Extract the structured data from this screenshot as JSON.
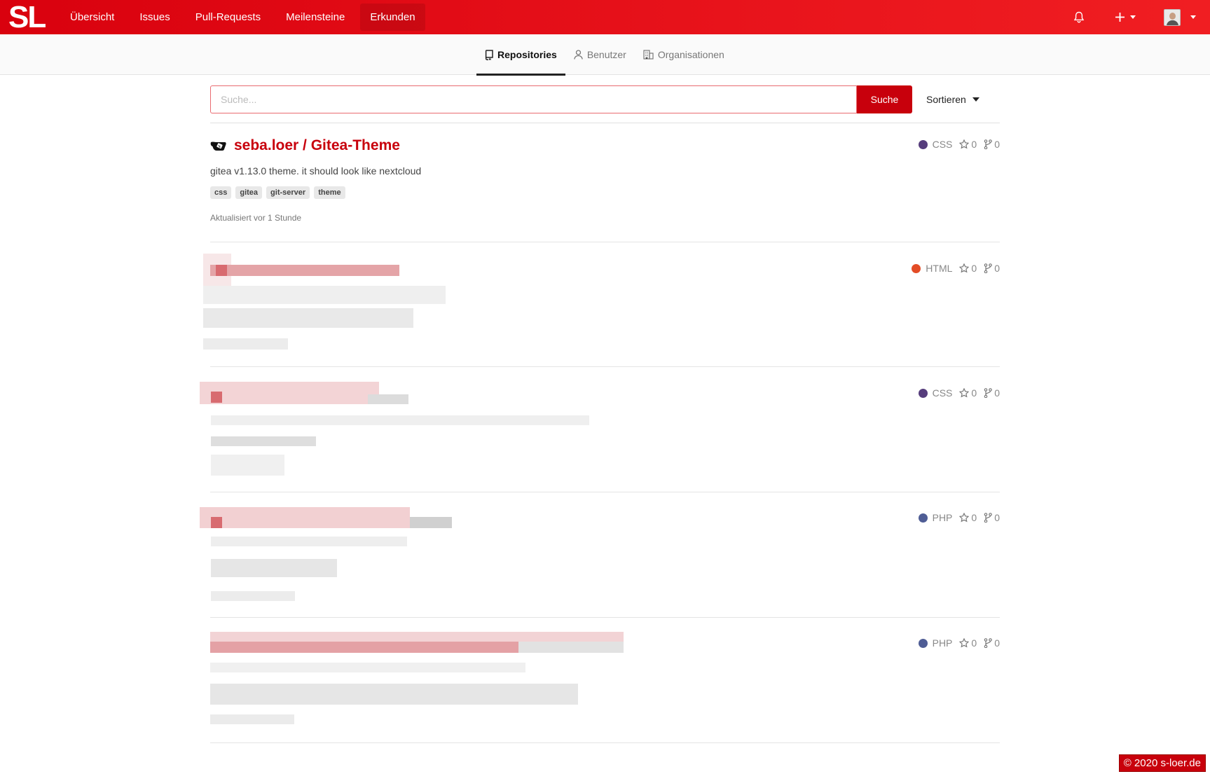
{
  "app": {
    "logo_text": "SL",
    "nav": [
      {
        "label": "Übersicht"
      },
      {
        "label": "Issues"
      },
      {
        "label": "Pull-Requests"
      },
      {
        "label": "Meilensteine"
      },
      {
        "label": "Erkunden",
        "active": true
      }
    ],
    "icons": {
      "notifications": "bell-icon",
      "create": "plus-icon",
      "user_menu": "avatar"
    }
  },
  "explore": {
    "tabs": [
      {
        "label": "Repositories",
        "icon": "repo-icon",
        "active": true
      },
      {
        "label": "Benutzer",
        "icon": "user-icon"
      },
      {
        "label": "Organisationen",
        "icon": "organization-icon"
      }
    ],
    "search": {
      "placeholder": "Suche...",
      "value": "",
      "button_label": "Suche"
    },
    "sort_label": "Sortieren"
  },
  "repos": [
    {
      "title": "seba.loer / Gitea-Theme",
      "description": "gitea v1.13.0 theme. it should look like nextcloud",
      "topics": [
        "css",
        "gitea",
        "git-server",
        "theme"
      ],
      "updated": "Aktualisiert vor 1 Stunde",
      "language": "CSS",
      "language_color": "#563d7c",
      "stars": "0",
      "forks": "0"
    },
    {
      "redacted": true,
      "language": "HTML",
      "language_color": "#e34c26",
      "stars": "0",
      "forks": "0"
    },
    {
      "redacted": true,
      "language": "CSS",
      "language_color": "#563d7c",
      "stars": "0",
      "forks": "0"
    },
    {
      "redacted": true,
      "language": "PHP",
      "language_color": "#4f5d95",
      "stars": "0",
      "forks": "0"
    },
    {
      "redacted": true,
      "language": "PHP",
      "language_color": "#4f5d95",
      "stars": "0",
      "forks": "0"
    }
  ],
  "footer": {
    "text": "© 2020 s-loer.de"
  },
  "colors": {
    "brand": "#c8000c",
    "navbar": "#e8131b"
  }
}
